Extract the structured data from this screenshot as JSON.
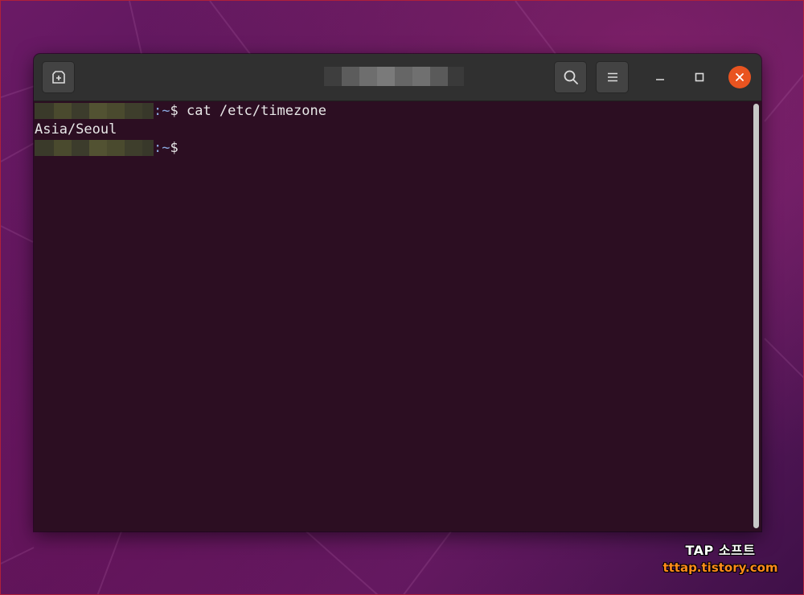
{
  "window": {
    "title": ""
  },
  "toolbar": {
    "new_tab_icon": "new-tab-icon",
    "search_icon": "search-icon",
    "menu_icon": "hamburger-menu-icon",
    "minimize_icon": "minimize-icon",
    "maximize_icon": "maximize-icon",
    "close_icon": "close-icon"
  },
  "terminal": {
    "lines": [
      {
        "prompt_path": ":~",
        "prompt_symbol": "$",
        "command": " cat /etc/timezone"
      },
      {
        "output": "Asia/Seoul"
      },
      {
        "prompt_path": ":~",
        "prompt_symbol": "$",
        "command": ""
      }
    ]
  },
  "watermark": {
    "title": "TAP 소프트",
    "url": "tttap.tistory.com"
  },
  "colors": {
    "background": "#2c0e22",
    "headerbar": "#303030",
    "close_button": "#e95420",
    "prompt_path": "#8aa9df",
    "watermark_url": "#ff8c1a"
  }
}
